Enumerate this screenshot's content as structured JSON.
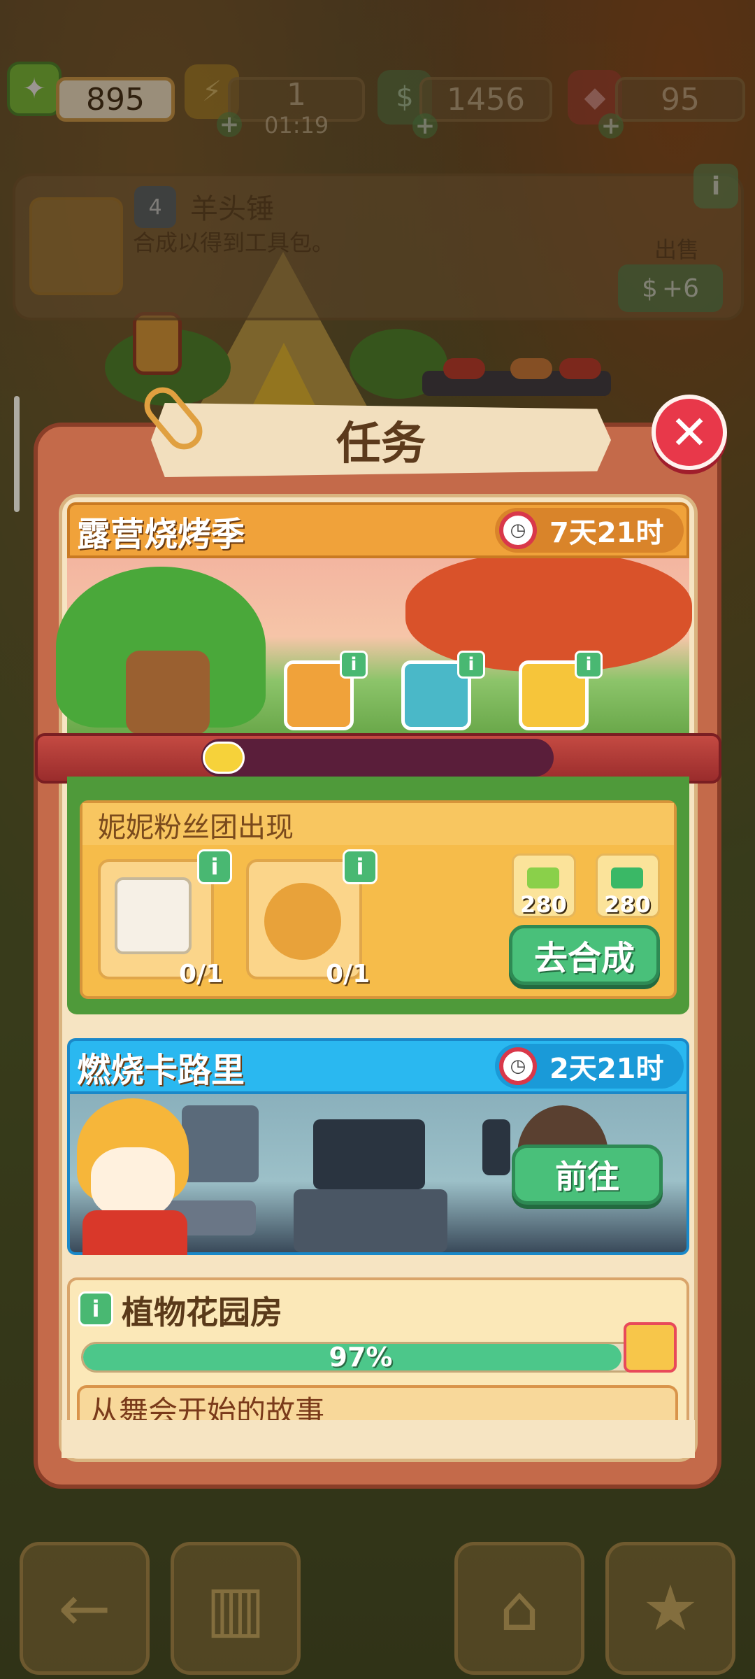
{
  "resources": {
    "leaf_ticket": {
      "value": "895",
      "icon": "leaf-ticket-icon"
    },
    "energy": {
      "value": "1",
      "timer": "01:19",
      "icon": "lightning-icon"
    },
    "cash": {
      "value": "1456",
      "icon": "cash-stack-icon"
    },
    "gems": {
      "value": "95",
      "icon": "ruby-icon"
    }
  },
  "item_info": {
    "level": "4",
    "name": "羊头锤",
    "description": "合成以得到工具包。",
    "sell_label": "出售",
    "sell_value": "+6"
  },
  "panel": {
    "title": "任务",
    "close_icon": "close-icon"
  },
  "event_bbq": {
    "title": "露营烧烤季",
    "timer": "7天21时",
    "progress": 0.12,
    "chests": [
      "orange-chest-icon",
      "blue-chest-icon",
      "gold-chest-icon"
    ]
  },
  "sub_mission": {
    "title": "妮妮粉丝团出现",
    "items": [
      {
        "name": "photo-frame-item",
        "count": "0/1"
      },
      {
        "name": "picnic-character-item",
        "count": "0/1"
      }
    ],
    "rewards": [
      {
        "icon": "leaf-ticket-icon",
        "value": "280"
      },
      {
        "icon": "cash-icon",
        "value": "280"
      }
    ],
    "button": "去合成"
  },
  "event_calorie": {
    "title": "燃烧卡路里",
    "timer": "2天21时",
    "button": "前往"
  },
  "plant_house": {
    "title": "植物花园房",
    "progress": 0.97,
    "progress_label": "97%",
    "story": "从舞会开始的故事"
  },
  "colors": {
    "accent_green": "#49c07a",
    "close_red": "#e8384a",
    "bbq_orange": "#f0a23a",
    "calorie_blue": "#2ab8f0"
  },
  "nav": [
    "back-arrow-icon",
    "podium-icon",
    "basket-icon",
    "clipboard-star-icon"
  ]
}
